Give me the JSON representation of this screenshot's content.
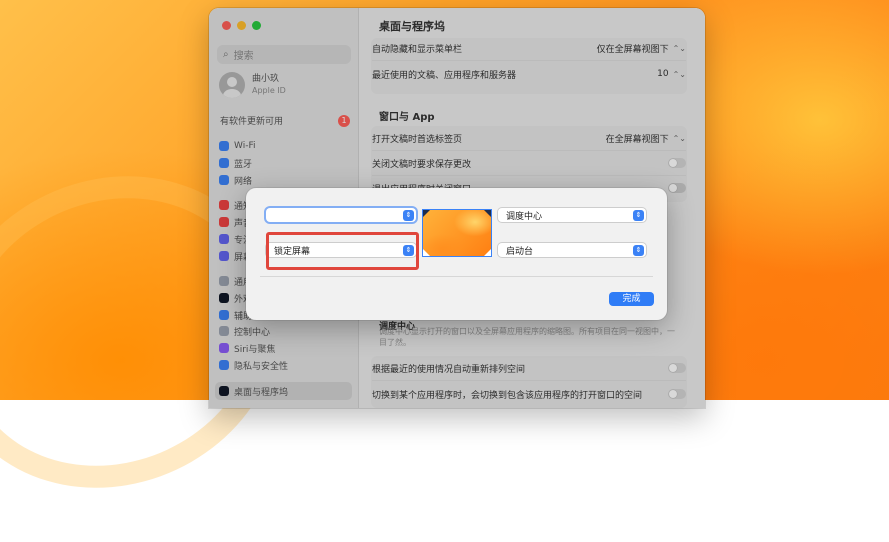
{
  "window": {
    "title": "桌面与程序坞"
  },
  "sidebar": {
    "search_placeholder": "搜索",
    "account": {
      "name": "曲小玖",
      "sub": "Apple ID"
    },
    "update": {
      "label": "有软件更新可用",
      "count": "1"
    },
    "items": [
      {
        "label": "Wi-Fi",
        "icon": "wifi-icon",
        "color": "#3b82f6"
      },
      {
        "label": "蓝牙",
        "icon": "bluetooth-icon",
        "color": "#3b82f6"
      },
      {
        "label": "网络",
        "icon": "network-icon",
        "color": "#3b82f6"
      },
      {
        "label": "通知",
        "icon": "notifications-icon",
        "color": "#ef4444"
      },
      {
        "label": "声音",
        "icon": "sound-icon",
        "color": "#ef4444"
      },
      {
        "label": "专注模式",
        "icon": "focus-icon",
        "color": "#6366f1"
      },
      {
        "label": "屏幕使用时间",
        "icon": "screen-time-icon",
        "color": "#6366f1"
      },
      {
        "label": "通用",
        "icon": "general-icon",
        "color": "#9ca3af"
      },
      {
        "label": "外观",
        "icon": "appearance-icon",
        "color": "#111827"
      },
      {
        "label": "辅助功能",
        "icon": "accessibility-icon",
        "color": "#3b82f6"
      },
      {
        "label": "控制中心",
        "icon": "control-center-icon",
        "color": "#9ca3af"
      },
      {
        "label": "Siri与聚焦",
        "icon": "siri-icon",
        "color": "#8b5cf6"
      },
      {
        "label": "隐私与安全性",
        "icon": "privacy-icon",
        "color": "#3b82f6"
      },
      {
        "label": "桌面与程序坞",
        "icon": "desktop-dock-icon",
        "color": "#111827"
      }
    ]
  },
  "settings": {
    "rows_top": [
      {
        "label": "自动隐藏和显示菜单栏",
        "value": "仅在全屏幕视图下"
      },
      {
        "label": "最近使用的文稿、应用程序和服务器",
        "value": "10"
      }
    ],
    "windows_group": {
      "heading": "窗口与 App",
      "rows": [
        {
          "label": "打开文稿时首选标签页",
          "value": "在全屏幕视图下"
        },
        {
          "label": "关闭文稿时要求保存更改",
          "toggle": false
        },
        {
          "label": "退出应用程序时关闭窗口",
          "toggle": true
        }
      ]
    },
    "mission_control": {
      "heading": "调度中心",
      "description": "调度中心显示打开的窗口以及全屏幕应用程序的缩略图。所有项目在同一视图中，一目了然。",
      "rows": [
        {
          "label": "根据最近的使用情况自动重新排列空间",
          "toggle": false
        },
        {
          "label": "切换到某个应用程序时，会切换到包含该应用程序的打开窗口的空间",
          "toggle": false
        }
      ]
    }
  },
  "hot_corners_sheet": {
    "top_left_value": "",
    "top_right_value": "调度中心",
    "bottom_left_value": "锁定屏幕",
    "bottom_right_value": "启动台",
    "done_label": "完成"
  },
  "colors": {
    "accent": "#2f7cf6",
    "highlight": "#e0463c"
  }
}
